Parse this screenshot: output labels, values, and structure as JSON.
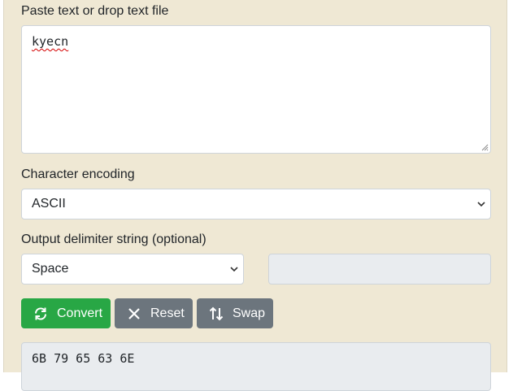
{
  "input": {
    "label": "Paste text or drop text file",
    "value": "kyecn"
  },
  "encoding": {
    "label": "Character encoding",
    "selected": "ASCII"
  },
  "delimiter": {
    "label": "Output delimiter string (optional)",
    "selected": "Space",
    "custom_value": ""
  },
  "buttons": {
    "convert": "Convert",
    "reset": "Reset",
    "swap": "Swap"
  },
  "output": {
    "value": "6B 79 65 63 6E"
  },
  "colors": {
    "panel_bg": "#efe8d4",
    "convert_button": "#28a745",
    "secondary_button": "#6c757d",
    "disabled_field": "#e9ecef"
  },
  "icons": [
    "refresh-icon",
    "close-icon",
    "swap-vertical-icon",
    "chevron-down-icon",
    "resize-grip-icon"
  ]
}
